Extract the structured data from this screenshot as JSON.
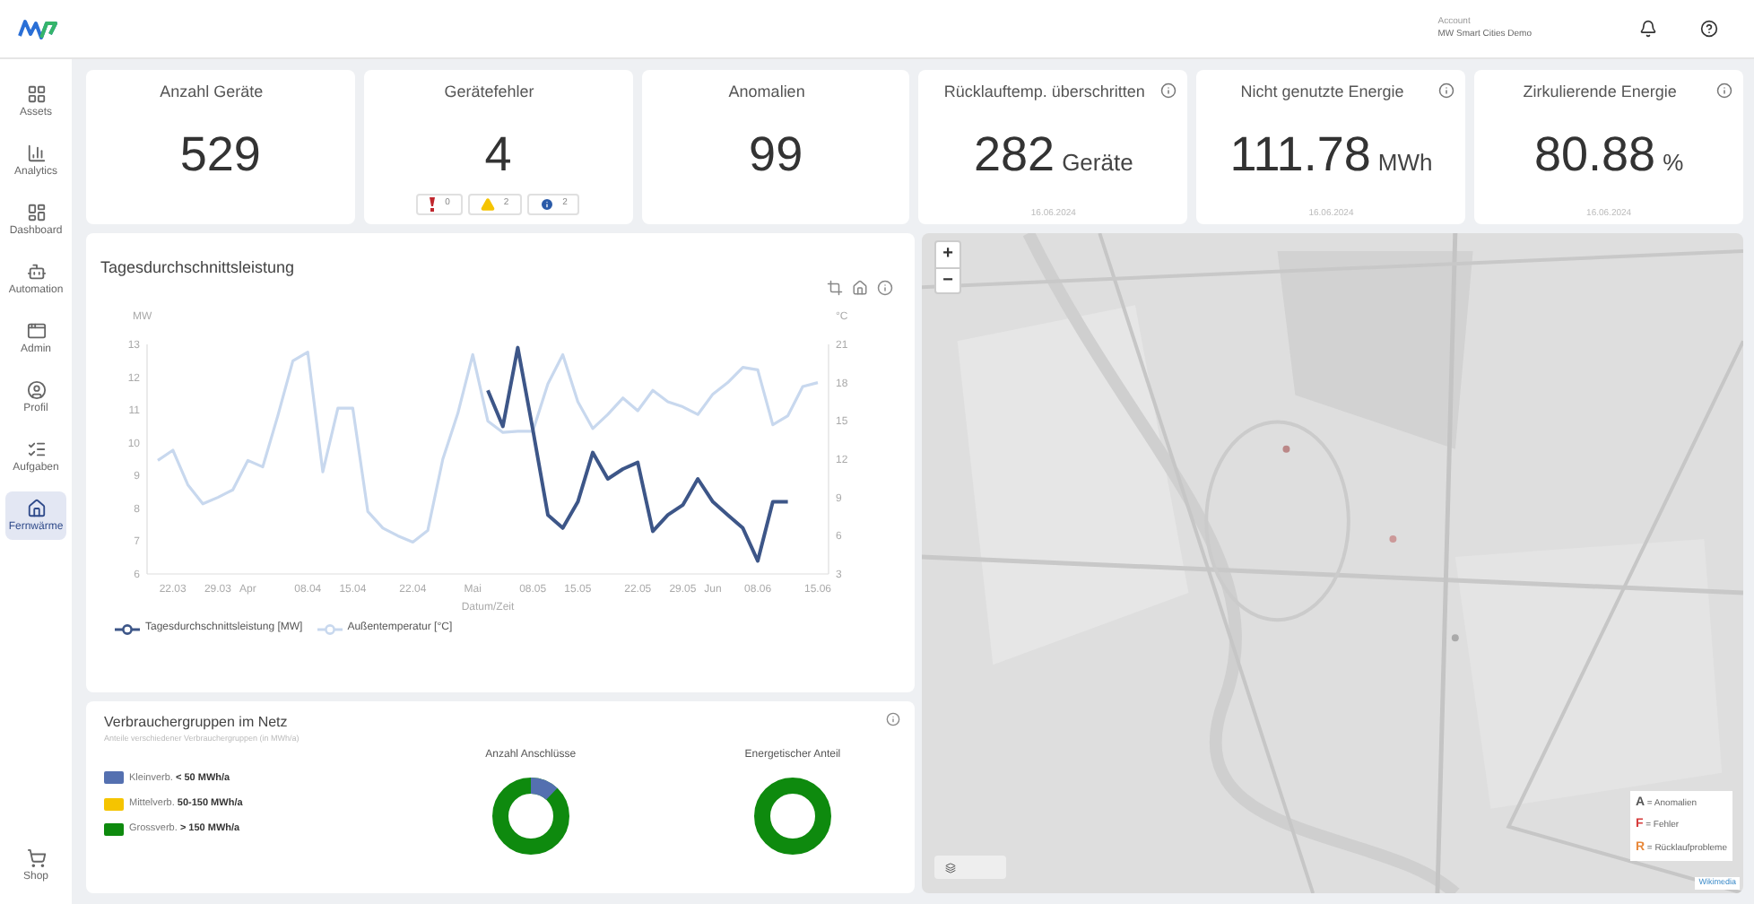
{
  "header": {
    "account_label": "Account",
    "account_name": "MW Smart Cities Demo"
  },
  "sidebar": {
    "items": [
      {
        "label": "Assets",
        "selected": false
      },
      {
        "label": "Analytics",
        "selected": false
      },
      {
        "label": "Dashboard",
        "selected": false
      },
      {
        "label": "Automation",
        "selected": false
      },
      {
        "label": "Admin",
        "selected": false
      },
      {
        "label": "Profil",
        "selected": false
      },
      {
        "label": "Aufgaben",
        "selected": false
      },
      {
        "label": "Fernwärme",
        "selected": true
      }
    ],
    "bottom_item": {
      "label": "Shop",
      "selected": false
    }
  },
  "kpis": [
    {
      "title": "Anzahl Geräte",
      "value": "529"
    },
    {
      "title": "Gerätefehler",
      "value": "4",
      "badges": [
        {
          "kind": "error",
          "count": "0"
        },
        {
          "kind": "warning",
          "count": "2"
        },
        {
          "kind": "info",
          "count": "2"
        }
      ]
    },
    {
      "title": "Anomalien",
      "value": "99"
    },
    {
      "title": "Rücklauftemp. überschritten",
      "value": "282",
      "unit": "Geräte",
      "date": "16.06.2024",
      "info": true
    },
    {
      "title": "Nicht genutzte Energie",
      "value": "111.78",
      "unit": "MWh",
      "date": "16.06.2024",
      "info": true
    },
    {
      "title": "Zirkulierende Energie",
      "value": "80.88",
      "unit": "%",
      "date": "16.06.2024",
      "info": true
    }
  ],
  "power_chart": {
    "title": "Tagesdurchschnittsleistung",
    "chart_data": {
      "type": "line",
      "xlabel": "Datum/Zeit",
      "ylabel": "MW",
      "y2label": "°C",
      "categories": [
        null,
        "22.03",
        null,
        null,
        "29.03",
        null,
        "Apr",
        null,
        null,
        null,
        "08.04",
        null,
        null,
        "15.04",
        null,
        null,
        null,
        "22.04",
        null,
        null,
        null,
        "Mai",
        null,
        null,
        null,
        "08.05",
        null,
        null,
        "15.05",
        null,
        null,
        null,
        "22.05",
        null,
        null,
        "29.05",
        null,
        "Jun",
        null,
        null,
        "08.06",
        null,
        null,
        null,
        "15.06"
      ],
      "series": [
        {
          "name": "Tagesdurchschnittsleistung [MW]",
          "color": "#3d5688",
          "axis": "y",
          "values": [
            null,
            null,
            null,
            null,
            null,
            null,
            null,
            null,
            null,
            null,
            null,
            null,
            null,
            null,
            null,
            null,
            null,
            null,
            null,
            null,
            null,
            null,
            11.6,
            10.5,
            12.9,
            10.4,
            7.8,
            7.4,
            8.2,
            9.7,
            8.9,
            9.2,
            9.4,
            7.3,
            7.8,
            8.1,
            8.9,
            8.2,
            7.8,
            7.4,
            6.4,
            8.2,
            8.2,
            null,
            null
          ]
        },
        {
          "name": "Außentemperatur [°C]",
          "color": "#c8d8ee",
          "axis": "y2",
          "values": [
            11.9,
            12.7,
            10.0,
            8.5,
            9.0,
            9.6,
            11.9,
            11.4,
            15.4,
            19.7,
            20.4,
            11.0,
            16.0,
            16.0,
            7.9,
            6.6,
            6.0,
            5.5,
            6.4,
            12.0,
            15.6,
            20.2,
            15.0,
            14.1,
            14.2,
            14.2,
            17.9,
            20.2,
            16.5,
            14.4,
            15.5,
            16.8,
            15.8,
            17.4,
            16.5,
            16.1,
            15.5,
            17.1,
            18.0,
            19.2,
            19.0,
            14.7,
            15.4,
            17.7,
            18.0
          ]
        }
      ],
      "ylim": [
        6,
        13
      ],
      "y2lim": [
        3,
        21
      ],
      "yticks": [
        6,
        7,
        8,
        9,
        10,
        11,
        12,
        13
      ],
      "y2ticks": [
        3,
        6,
        9,
        12,
        15,
        18,
        21
      ]
    }
  },
  "consumer_groups": {
    "title": "Verbrauchergruppen im Netz",
    "subtitle": "Anteile verschiedener Verbrauchergruppen (in MWh/a)",
    "legend": [
      {
        "name": "Kleinverb.",
        "range": "< 50 MWh/a",
        "color": "#5470b0"
      },
      {
        "name": "Mittelverb.",
        "range": "50-150 MWh/a",
        "color": "#f5c400"
      },
      {
        "name": "Grossverb.",
        "range": "> 150 MWh/a",
        "color": "#0e8a0e"
      }
    ],
    "donuts": [
      {
        "title": "Anzahl Anschlüsse"
      },
      {
        "title": "Energetischer Anteil"
      }
    ]
  },
  "map": {
    "zoom_in": "+",
    "zoom_out": "−",
    "legend": [
      {
        "letter": "A",
        "text": "= Anomalien",
        "color": "#555555"
      },
      {
        "letter": "F",
        "text": "= Fehler",
        "color": "#d63a3a"
      },
      {
        "letter": "R",
        "text": "= Rücklaufprobleme",
        "color": "#e8883a"
      }
    ],
    "attribution": "Wikimedia"
  }
}
